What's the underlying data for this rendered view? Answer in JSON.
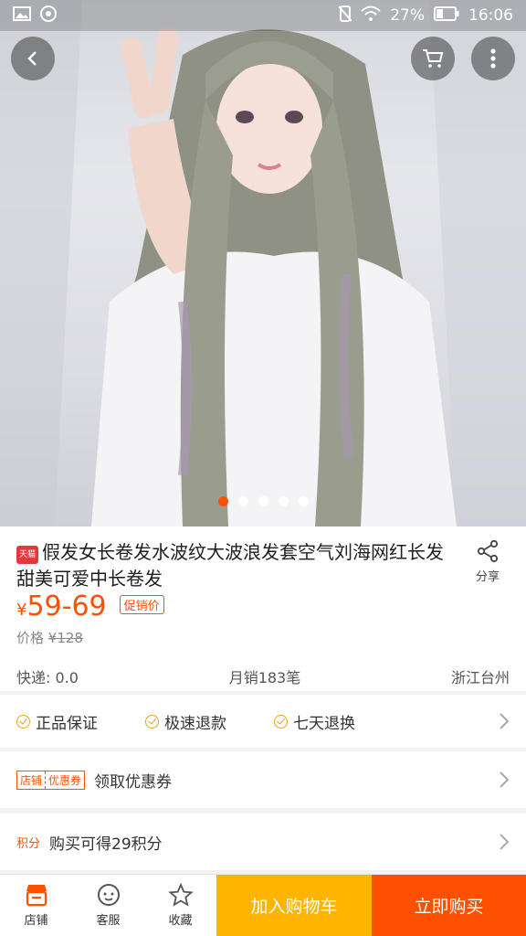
{
  "statusbar": {
    "battery": "27%",
    "time": "16:06"
  },
  "product": {
    "badge": "天猫",
    "title": "假发女长卷发水波纹大波浪发套空气刘海网红长发甜美可爱中长卷发",
    "share_label": "分享",
    "currency": "¥",
    "price": "59-69",
    "promo_label": "促销价",
    "origin_label": "价格",
    "origin_price": "¥128",
    "shipping": "快递: 0.0",
    "monthly_sales": "月销183笔",
    "location": "浙江台州"
  },
  "carousel": {
    "count": 5,
    "active": 0
  },
  "services": {
    "items": [
      "正品保证",
      "极速退款",
      "七天退换"
    ],
    "coupon_tag_a": "店铺",
    "coupon_tag_b": "优惠券",
    "coupon_label": "领取优惠券",
    "points_tag": "积分",
    "points_label": "购买可得29积分"
  },
  "bottom": {
    "shop": "店铺",
    "service": "客服",
    "favorite": "收藏",
    "add_cart": "加入购物车",
    "buy_now": "立即购买"
  },
  "colors": {
    "accent": "#ff5000",
    "cart_button": "#ffb400",
    "check": "#e6a020"
  },
  "icons": [
    "image-icon",
    "music-icon",
    "mute-icon",
    "wifi-icon",
    "battery-icon",
    "back-icon",
    "cart-icon",
    "more-icon",
    "share-icon",
    "chevron-right-icon",
    "shop-icon",
    "service-icon",
    "star-icon"
  ]
}
